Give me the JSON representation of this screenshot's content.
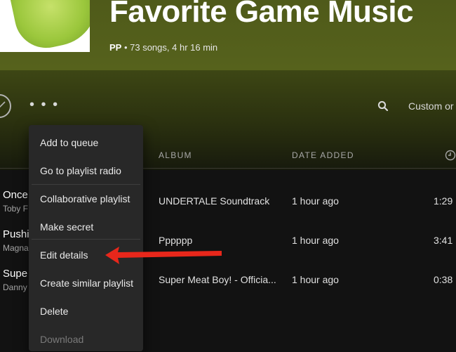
{
  "playlist": {
    "title": "Favorite Game Music",
    "owner": "PP",
    "summary": "• 73 songs, 4 hr 16 min"
  },
  "toolbar": {
    "more_label": "• • •",
    "sort_label": "Custom or"
  },
  "columns": {
    "album": "ALBUM",
    "date_added": "DATE ADDED"
  },
  "tracks": [
    {
      "title": "Once",
      "artist": "Toby F",
      "album": "UNDERTALE Soundtrack",
      "added": "1 hour ago",
      "duration": "1:29"
    },
    {
      "title": "Pushi",
      "artist": "Magna",
      "album": "Pppppp",
      "added": "1 hour ago",
      "duration": "3:41"
    },
    {
      "title": "Supe",
      "artist": "Danny",
      "album": "Super Meat Boy! - Officia...",
      "added": "1 hour ago",
      "duration": "0:38"
    }
  ],
  "context_menu": {
    "items": [
      {
        "label": "Add to queue"
      },
      {
        "label": "Go to playlist radio"
      },
      {
        "label": "Collaborative playlist"
      },
      {
        "label": "Make secret"
      },
      {
        "label": "Edit details"
      },
      {
        "label": "Create similar playlist"
      },
      {
        "label": "Delete"
      },
      {
        "label": "Download"
      }
    ]
  },
  "colors": {
    "header_green": "#56621c",
    "background": "#121212",
    "menu_bg": "#282828",
    "arrow_red": "#e8271b"
  },
  "icons": {
    "check": "check-circle-icon",
    "search": "search-icon",
    "clock": "clock-icon",
    "arrow": "red-arrow-annotation"
  }
}
